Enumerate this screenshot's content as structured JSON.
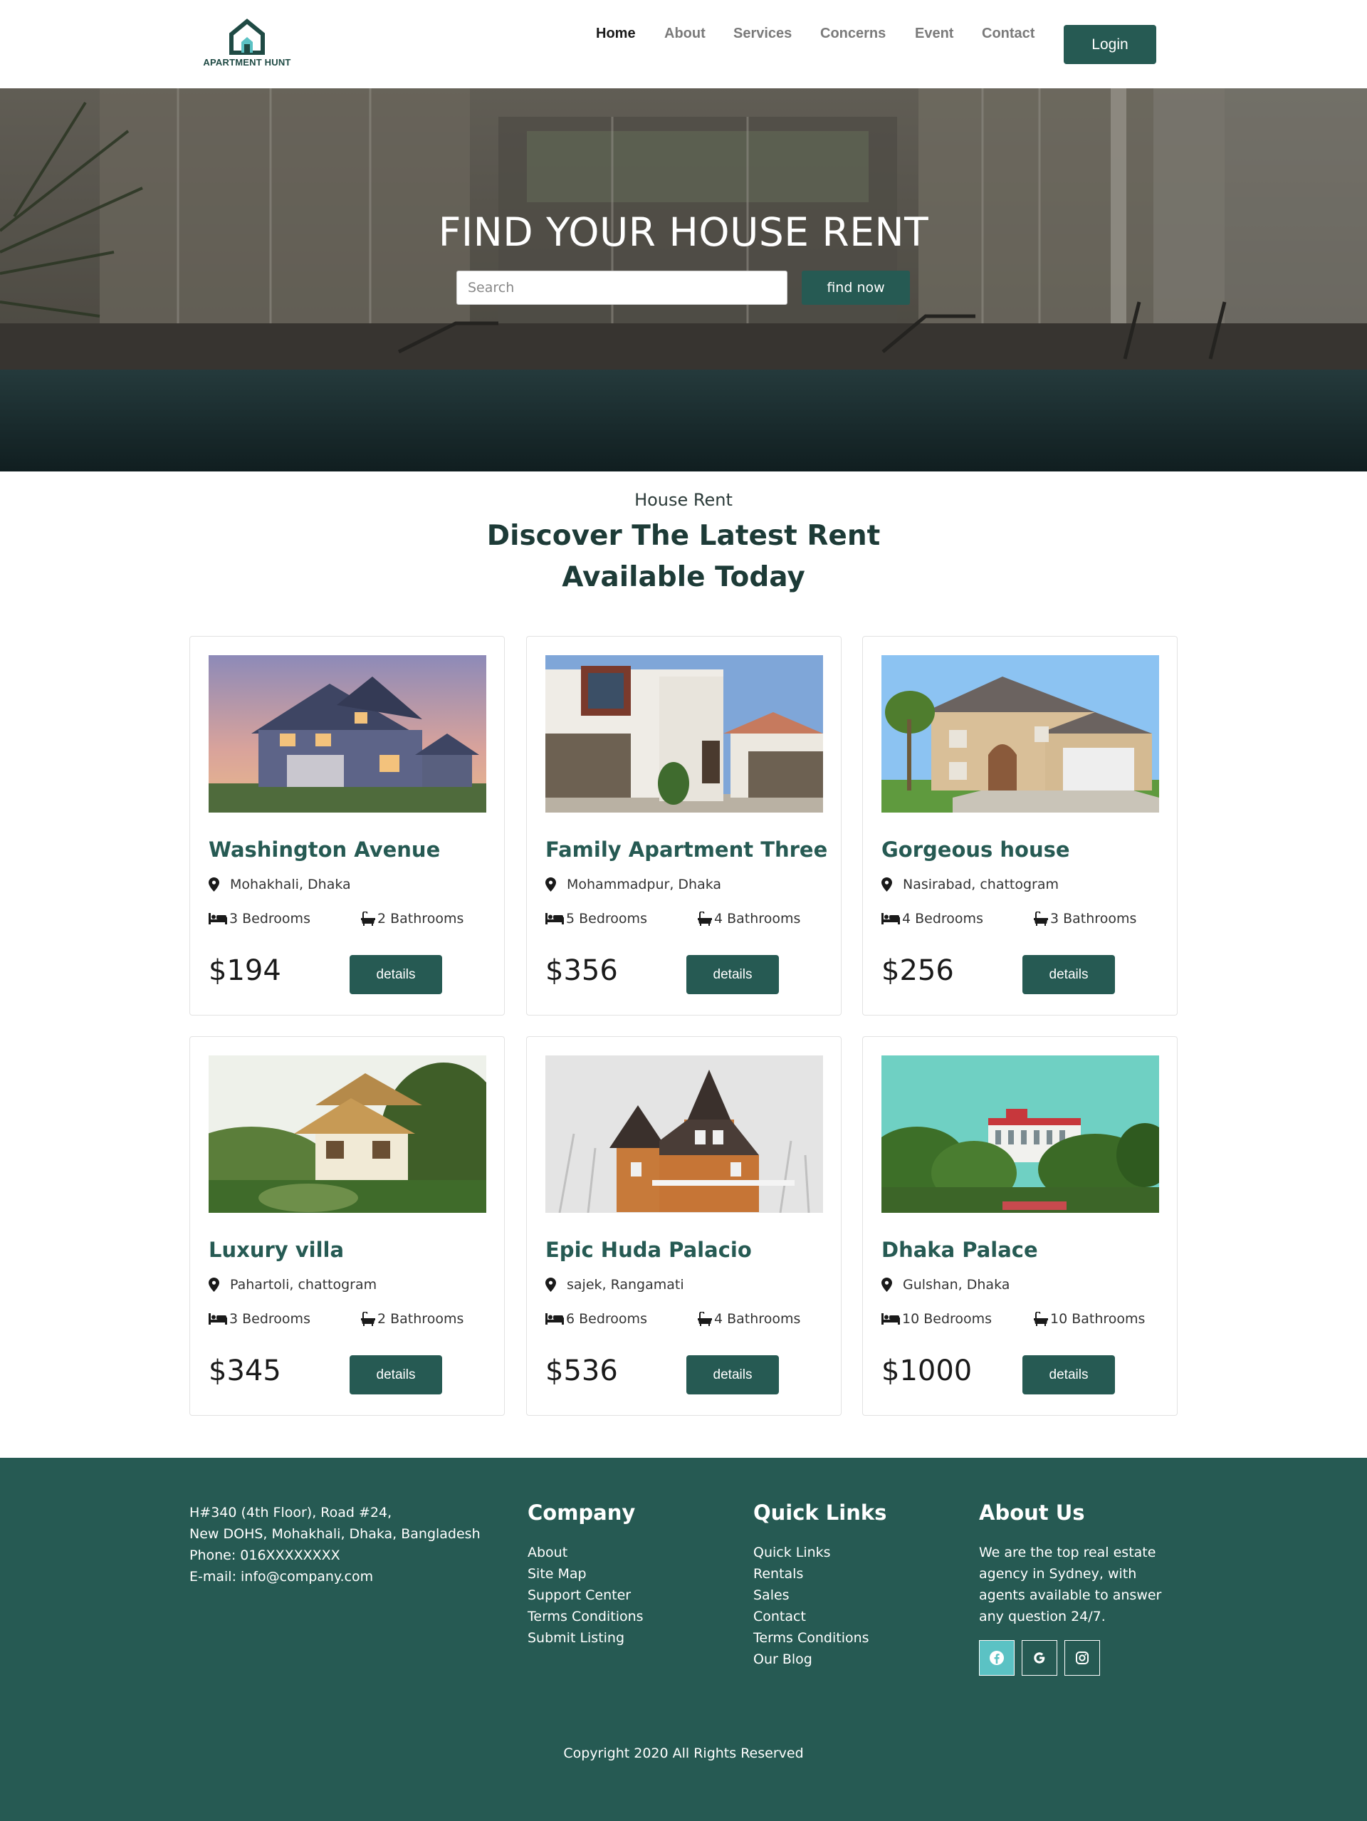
{
  "brand": {
    "name": "APARTMENT HUNT",
    "color": "#265a53"
  },
  "nav": {
    "links": [
      "Home",
      "About",
      "Services",
      "Concerns",
      "Event",
      "Contact"
    ],
    "active": "Home",
    "login_label": "Login"
  },
  "hero": {
    "title": "FIND YOUR HOUSE RENT",
    "search_placeholder": "Search",
    "button_label": "find now"
  },
  "section": {
    "subtitle": "House Rent",
    "title_line1": "Discover The Latest Rent",
    "title_line2": "Available Today"
  },
  "listings": [
    {
      "title": "Washington Avenue",
      "location": "Mohakhali, Dhaka",
      "bedrooms": "3 Bedrooms",
      "bathrooms": "2 Bathrooms",
      "price": "$194",
      "button": "details",
      "image": "suburban-house-dusk"
    },
    {
      "title": "Family Apartment Three",
      "location": "Mohammadpur, Dhaka",
      "bedrooms": "5 Bedrooms",
      "bathrooms": "4 Bathrooms",
      "price": "$356",
      "button": "details",
      "image": "white-villa-garage"
    },
    {
      "title": "Gorgeous house",
      "location": "Nasirabad, chattogram",
      "bedrooms": "4 Bedrooms",
      "bathrooms": "3 Bathrooms",
      "price": "$256",
      "button": "details",
      "image": "beige-two-story-house"
    },
    {
      "title": "Luxury villa",
      "location": "Pahartoli, chattogram",
      "bedrooms": "3 Bedrooms",
      "bathrooms": "2 Bathrooms",
      "price": "$345",
      "button": "details",
      "image": "thatched-roof-villa"
    },
    {
      "title": "Epic Huda Palacio",
      "location": "sajek, Rangamati",
      "bedrooms": "6 Bedrooms",
      "bathrooms": "4 Bathrooms",
      "price": "$536",
      "button": "details",
      "image": "victorian-house-snow"
    },
    {
      "title": "Dhaka Palace",
      "location": "Gulshan, Dhaka",
      "bedrooms": "10 Bedrooms",
      "bathrooms": "10 Bathrooms",
      "price": "$1000",
      "button": "details",
      "image": "palace-among-trees"
    }
  ],
  "footer": {
    "address_lines": [
      "H#340 (4th Floor), Road #24,",
      "New DOHS, Mohakhali, Dhaka, Bangladesh",
      "Phone: 016XXXXXXXX",
      "E-mail: info@company.com"
    ],
    "company": {
      "heading": "Company",
      "links": [
        "About",
        "Site Map",
        "Support Center",
        "Terms Conditions",
        "Submit Listing"
      ]
    },
    "quick_links": {
      "heading": "Quick Links",
      "links": [
        "Quick Links",
        "Rentals",
        "Sales",
        "Contact",
        "Terms Conditions",
        "Our Blog"
      ]
    },
    "about": {
      "heading": "About Us",
      "text": "We are the top real estate agency in Sydney, with agents available to answer any question 24/7.",
      "socials": [
        "facebook-icon",
        "google-icon",
        "instagram-icon"
      ],
      "social_active_color": "#5bc2c4"
    },
    "copyright": "Copyright 2020 All Rights Reserved"
  }
}
